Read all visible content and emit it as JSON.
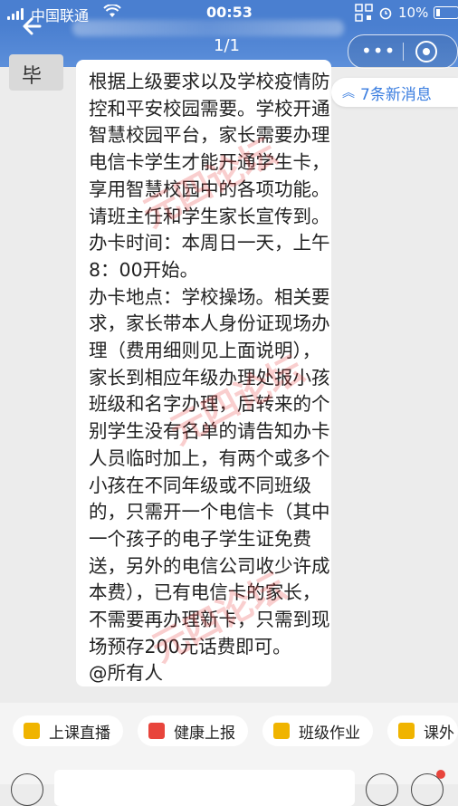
{
  "status_bar": {
    "carrier": "中国联通",
    "time": "00:53",
    "battery": "10%"
  },
  "nav": {
    "page_counter": "1/1"
  },
  "chat": {
    "avatar_text": "毕 竹",
    "message": "根据上级要求以及学校疫情防\n控和平安校园需要。学校开通\n智慧校园平台，家长需要办理\n电信卡学生才能开通学生卡，\n享用智慧校园中的各项功能。\n请班主任和学生家长宣传到。\n办卡时间：本周日一天，上午\n8：00开始。\n办卡地点：学校操场。相关要\n求，家长带本人身份证现场办\n理（费用细则见上面说明），\n家长到相应年级办理处报小孩\n班级和名字办理，后转来的个\n别学生没有名单的请告知办卡\n人员临时加上，有两个或多个\n小孩在不同年级或不同班级\n的，只需开一个电信卡（其中\n一个孩子的电子学生证免费\n送，另外的电信公司收少许成\n本费），已有电信卡的家长，\n不需要再办理新卡，只需到现\n场预存200元话费即可。\n@所有人",
    "new_messages": "7条新消息",
    "watermarks": [
      "元四论坛",
      "元四论坛",
      "元四论坛"
    ]
  },
  "quick_actions": [
    {
      "label": "上课直播",
      "icon": "live-icon",
      "color": "#f0b400"
    },
    {
      "label": "健康上报",
      "icon": "health-report-icon",
      "color": "#e8453c"
    },
    {
      "label": "班级作业",
      "icon": "homework-icon",
      "color": "#f0b400"
    },
    {
      "label": "课外",
      "icon": "extracurricular-icon",
      "color": "#f0b400"
    }
  ]
}
